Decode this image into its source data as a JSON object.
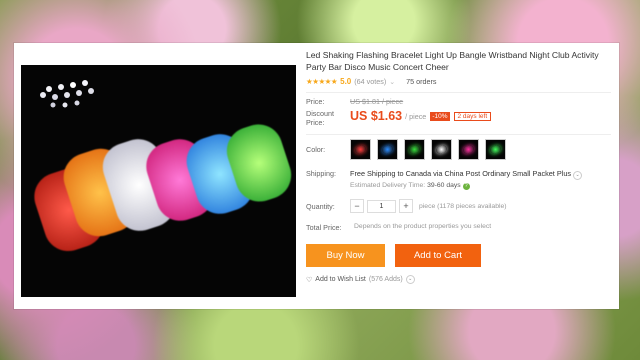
{
  "product": {
    "title": "Led Shaking Flashing Bracelet Light Up Bangle Wristband Night Club Activity Party Bar Disco Music Concert Cheer",
    "rating": {
      "stars_icon": "star-icon",
      "value": "5.0",
      "votes": "(64 votes)",
      "orders": "75 orders"
    }
  },
  "price": {
    "label": "Price:",
    "original": "US $1.81 / piece",
    "discount_label": "Discount Price:",
    "discount_value": "US $1.63",
    "per_unit": "/ piece",
    "off_badge": "-10%",
    "time_left": "2 days left"
  },
  "color": {
    "label": "Color:",
    "swatches": [
      "#ff3a3a",
      "#2a8cff",
      "#36e03a",
      "#ffffff",
      "#ff2fa0",
      "#3fff5a"
    ]
  },
  "shipping": {
    "label": "Shipping:",
    "text": "Free Shipping to Canada via China Post Ordinary Small Packet Plus",
    "delivery_label": "Estimated Delivery Time:",
    "delivery_value": "39-60 days"
  },
  "quantity": {
    "label": "Quantity:",
    "value": "1",
    "minus": "−",
    "plus": "+",
    "available": "piece (1178 pieces available)"
  },
  "total": {
    "label": "Total Price:",
    "hint": "Depends on the product properties you select"
  },
  "actions": {
    "buy_now": "Buy Now",
    "add_to_cart": "Add to Cart",
    "wish_label": "Add to Wish List",
    "wish_count": "(576 Adds)"
  },
  "colors": {
    "accent": "#e94b1b",
    "buy": "#f7931e",
    "cart": "#f2620f",
    "star": "#f7a81b"
  }
}
